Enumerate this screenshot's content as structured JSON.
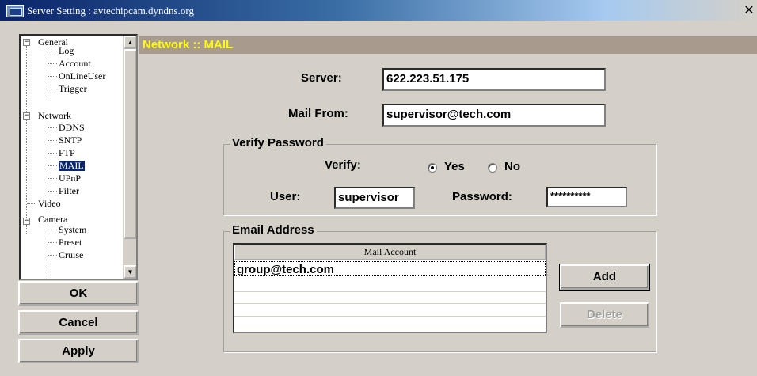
{
  "window": {
    "title": "Server Setting : avtechipcam.dyndns.org",
    "close_glyph": "✕"
  },
  "tree": {
    "toggle_expanded": "−",
    "scroll_up": "▲",
    "scroll_down": "▼",
    "items": [
      {
        "label": "General"
      },
      {
        "label": "Log"
      },
      {
        "label": "Account"
      },
      {
        "label": "OnLineUser"
      },
      {
        "label": "Trigger"
      },
      {
        "label": "Network"
      },
      {
        "label": "DDNS"
      },
      {
        "label": "SNTP"
      },
      {
        "label": "FTP"
      },
      {
        "label": "MAIL"
      },
      {
        "label": "UPnP"
      },
      {
        "label": "Filter"
      },
      {
        "label": "Video"
      },
      {
        "label": "Camera"
      },
      {
        "label": "System"
      },
      {
        "label": "Preset"
      },
      {
        "label": "Cruise"
      }
    ]
  },
  "left_buttons": {
    "ok": "OK",
    "cancel": "Cancel",
    "apply": "Apply"
  },
  "section": {
    "title": "Network :: MAIL",
    "title_color": "#ffff00",
    "bar_color": "#a89a8c"
  },
  "form": {
    "server_label": "Server:",
    "server_value": "622.223.51.175",
    "mail_from_label": "Mail From:",
    "mail_from_value": "supervisor@tech.com"
  },
  "verify": {
    "group_title": "Verify Password",
    "verify_label": "Verify:",
    "yes_label": "Yes",
    "no_label": "No",
    "selected": "Yes",
    "user_label": "User:",
    "user_value": "supervisor",
    "password_label": "Password:",
    "password_value": "**********"
  },
  "email": {
    "group_title": "Email Address",
    "column_header": "Mail Account",
    "rows": [
      "group@tech.com",
      "",
      "",
      "",
      ""
    ],
    "add_label": "Add",
    "delete_label": "Delete"
  }
}
